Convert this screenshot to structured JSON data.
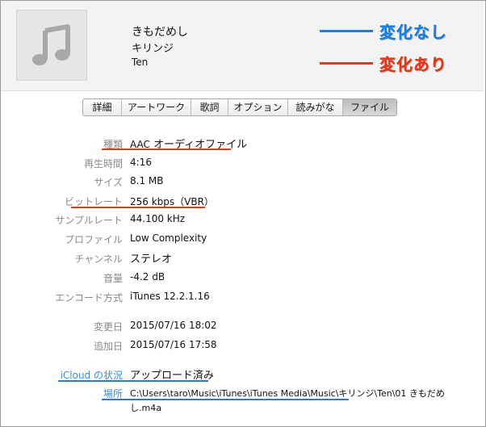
{
  "header": {
    "song_title": "きもだめし",
    "song_artist": "キリンジ",
    "song_album": "Ten"
  },
  "legend": {
    "unchanged_label": "変化なし",
    "unchanged_color": "#1a7fe0",
    "changed_label": "変化あり",
    "changed_color": "#e03a1a"
  },
  "tabs": [
    {
      "label": "詳細",
      "active": false
    },
    {
      "label": "アートワーク",
      "active": false
    },
    {
      "label": "歌詞",
      "active": false
    },
    {
      "label": "オプション",
      "active": false
    },
    {
      "label": "読みがな",
      "active": false
    },
    {
      "label": "ファイル",
      "active": true
    }
  ],
  "file_info": {
    "kind_label": "種類",
    "kind_prefix": "AAC",
    "kind_value": "オーディオファイル",
    "duration_label": "再生時間",
    "duration_value": "4:16",
    "size_label": "サイズ",
    "size_value": "8.1 MB",
    "bitrate_label": "ビットレート",
    "bitrate_value": "256 kbps（VBR）",
    "samplerate_label": "サンプルレート",
    "samplerate_value": "44.100 kHz",
    "profile_label": "プロファイル",
    "profile_value": "Low Complexity",
    "channel_label": "チャンネル",
    "channel_value": "ステレオ",
    "volume_label": "音量",
    "volume_value": "-4.2 dB",
    "encoder_label": "エンコード方式",
    "encoder_value": "iTunes 12.2.1.16",
    "modified_label": "変更日",
    "modified_value": "2015/07/16 18:02",
    "added_label": "追加日",
    "added_value": "2015/07/16 17:58",
    "icloud_label": "iCloud の状況",
    "icloud_value": "アップロード済み",
    "location_label": "場所",
    "location_value": "C:\\Users\\taro\\Music\\iTunes\\iTunes Media\\Music\\キリンジ\\Ten\\01 きもだめ",
    "location_value_cont": "し.m4a"
  }
}
